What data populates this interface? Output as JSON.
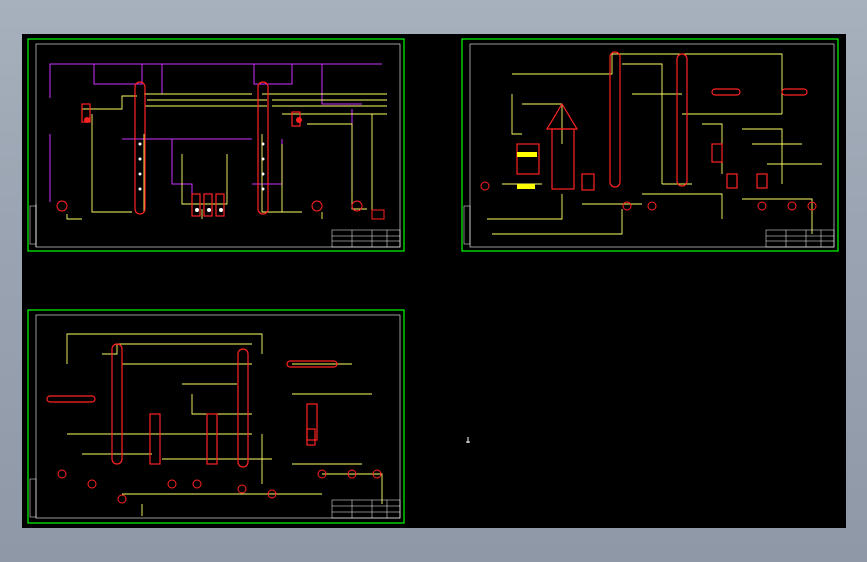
{
  "viewport": {
    "background": "#000000",
    "frame_bg": "#9aa4b2"
  },
  "colors": {
    "frame": "#00ff00",
    "inner_frame": "#ffffff",
    "pipe": "#ffff66",
    "utility": "#cc33ff",
    "equipment": "#ff2222",
    "instrument": "#ffffff",
    "title_block": "#ffffff"
  },
  "drawings": [
    {
      "id": "sheet-1",
      "layout": "two-column-process"
    },
    {
      "id": "sheet-2",
      "layout": "multi-column-process"
    },
    {
      "id": "sheet-3",
      "layout": "distillation-train"
    }
  ]
}
